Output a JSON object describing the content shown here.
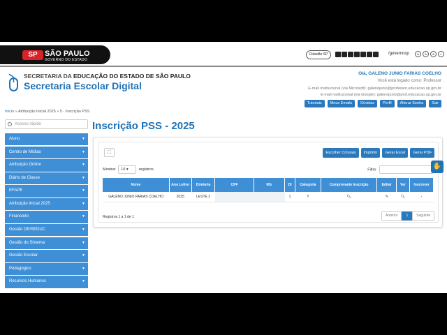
{
  "govbar": {
    "brand_title": "SÃO PAULO",
    "brand_sub": "GOVERNO DO ESTADO",
    "brand_mark": "SP",
    "cidadao": "Cidadão SP",
    "handle": "/governosp",
    "access_labels": [
      "A",
      "A",
      "A",
      "◐"
    ]
  },
  "header": {
    "secretaria_prefix": "SECRETARIA DA",
    "secretaria_name": "EDUCAÇÃO DO ESTADO DE SÃO PAULO",
    "app_title": "Secretaria Escolar Digital",
    "hello": "Olá, GALENO JUNIO FARIAS COELHO",
    "role": "Você está logado como: Professor",
    "mail_ms": "E-mail Institucional (via Microsoft): galenojunio@professor.educacao.sp.gov.br",
    "mail_google": "E-mail Institucional (via Google): galenojunio@prof.educacao.sp.gov.br",
    "links": [
      "Tutoriais",
      "Meus Emails",
      "Dúvidas",
      "Perfil",
      "Alterar Senha",
      "Sair"
    ]
  },
  "breadcrumb": {
    "home": "Início",
    "sep": "»",
    "step1": "Atribuição Inicial 2025",
    "step2": "5 - Inscrição PSS"
  },
  "sidebar": {
    "search_placeholder": "Acesso rápido",
    "items": [
      "Aluno",
      "Centro de Mídias",
      "Atribuição Online",
      "Diário de Classe",
      "EFAPE",
      "Atribuição Inicial 2025",
      "Financeiro",
      "Gestão DE/SEDUC",
      "Gestão do Sistema",
      "Gestão Escolar",
      "Pedagógico",
      "Recursos Humanos"
    ]
  },
  "main": {
    "title": "Inscrição PSS - 2025",
    "buttons": [
      "Escolher Colunas",
      "Imprimir",
      "Gerar Excel",
      "Gerar PDF"
    ],
    "show_label": "Mostrar",
    "show_value": "10",
    "show_suffix": "registros",
    "filter_label": "Filtro",
    "columns": [
      "Nome",
      "Ano Letivo",
      "Diretoria",
      "CPF",
      "RG",
      "DI",
      "Categoria",
      "Comprovante Inscrição",
      "Editar",
      "Ver",
      "Inscrever"
    ],
    "rows": [
      {
        "nome": "GALENO JUNIO FARIAS COELHO",
        "ano": "2025",
        "diretoria": "LESTE 2",
        "cpf": "",
        "rg": "",
        "di": "1",
        "categoria": "Y",
        "inscrever": "-"
      }
    ],
    "info": "Registros 1 a 1 de 1",
    "pager": [
      "Anterior",
      "1",
      "Seguinte"
    ]
  },
  "colors": {
    "accent": "#1f73b7",
    "menu": "#3e8fd6"
  }
}
